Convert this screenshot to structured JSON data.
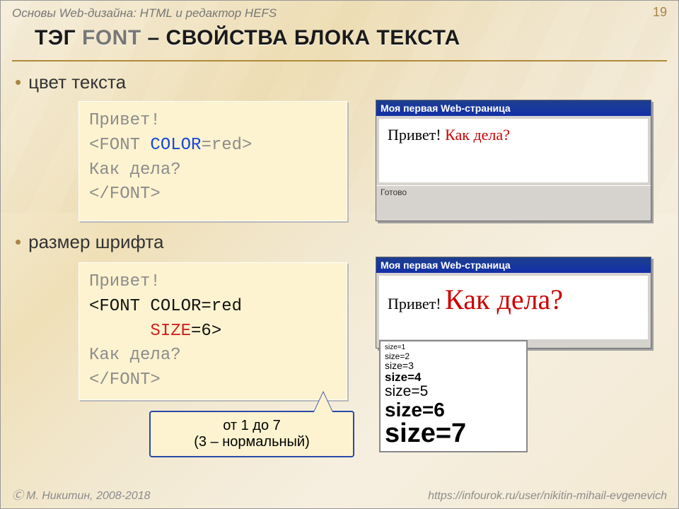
{
  "header": {
    "course": "Основы Web-дизайна: HTML и редактор HEFS",
    "page": "19"
  },
  "title": {
    "tag_word": "ТЭГ ",
    "font_word": "FONT",
    "rest": " – СВОЙСТВА БЛОКА ТЕКСТА"
  },
  "bullets": {
    "b1": "цвет текста",
    "b2": "размер шрифта"
  },
  "code1": {
    "l1": "Привет!",
    "l2a": "<FONT ",
    "l2b": "COLOR",
    "l2c": "=red>",
    "l3": "Как дела?",
    "l4": "</FONT>"
  },
  "code2": {
    "l1": "Привет!",
    "l2": "<FONT COLOR=red",
    "l3a": "      ",
    "l3b": "SIZE",
    "l3c": "=6>",
    "l4": "Как дела?",
    "l5": "</FONT>"
  },
  "win1": {
    "title": "Моя первая Web-страница",
    "black": "Привет! ",
    "red": "Как дела?",
    "status": "Готово"
  },
  "win2": {
    "title": "Моя первая Web-страница",
    "black": "Привет! ",
    "red": "Как дела?"
  },
  "sizes": [
    "size=1",
    "size=2",
    "size=3",
    "size=4",
    "size=5",
    "size=6",
    "size=7"
  ],
  "callout": {
    "l1": "от 1 до 7",
    "l2": "(3 – нормальный)"
  },
  "footer": {
    "author": "М. Никитин, 2008-2018",
    "url": "https://infourok.ru/user/nikitin-mihail-evgenevich"
  }
}
